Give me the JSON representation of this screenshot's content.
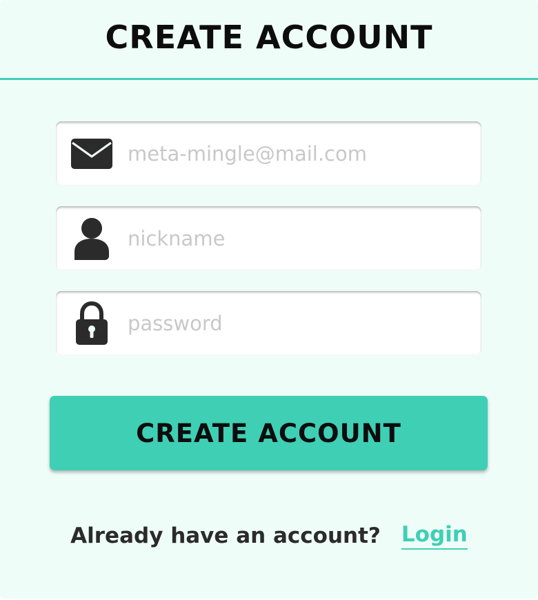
{
  "header": {
    "title": "CREATE ACCOUNT"
  },
  "form": {
    "email": {
      "icon": "envelope-icon",
      "value": "",
      "placeholder": "meta-mingle@mail.com"
    },
    "nickname": {
      "icon": "user-icon",
      "value": "",
      "placeholder": "nickname"
    },
    "password": {
      "icon": "lock-icon",
      "value": "",
      "placeholder": "password"
    },
    "submit_label": "CREATE ACCOUNT"
  },
  "footer": {
    "prompt": "Already have an account?",
    "login_label": "Login"
  },
  "colors": {
    "background": "#effdf8",
    "accent": "#3fcfb5",
    "divider": "#45cdb6",
    "icon": "#2b2b2b",
    "placeholder": "#c8c8c8"
  }
}
